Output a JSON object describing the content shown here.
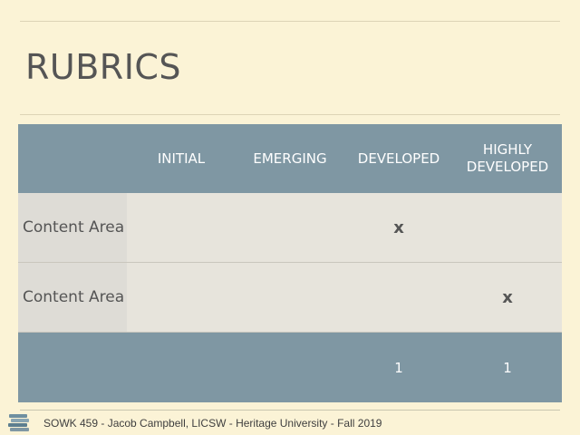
{
  "slide": {
    "title": "RUBRICS",
    "footer": "SOWK 459 - Jacob Campbell, LICSW - Heritage University - Fall 2019"
  },
  "rubric_table": {
    "header": [
      "",
      "INITIAL",
      "EMERGING",
      "DEVELOPED",
      "HIGHLY DEVELOPED"
    ],
    "rows": [
      {
        "label": "Content Area",
        "cells": [
          "",
          "",
          "x",
          ""
        ]
      },
      {
        "label": "Content Area",
        "cells": [
          "",
          "",
          "",
          "x"
        ]
      }
    ],
    "footer_row": [
      "",
      "",
      "",
      "1",
      "1"
    ]
  },
  "colors": {
    "background": "#fbf3d6",
    "header": "#7f97a3",
    "body": "#e7e4dc",
    "label_column": "#dedcd6",
    "text": "#555555"
  },
  "icons": [
    "books-icon"
  ]
}
